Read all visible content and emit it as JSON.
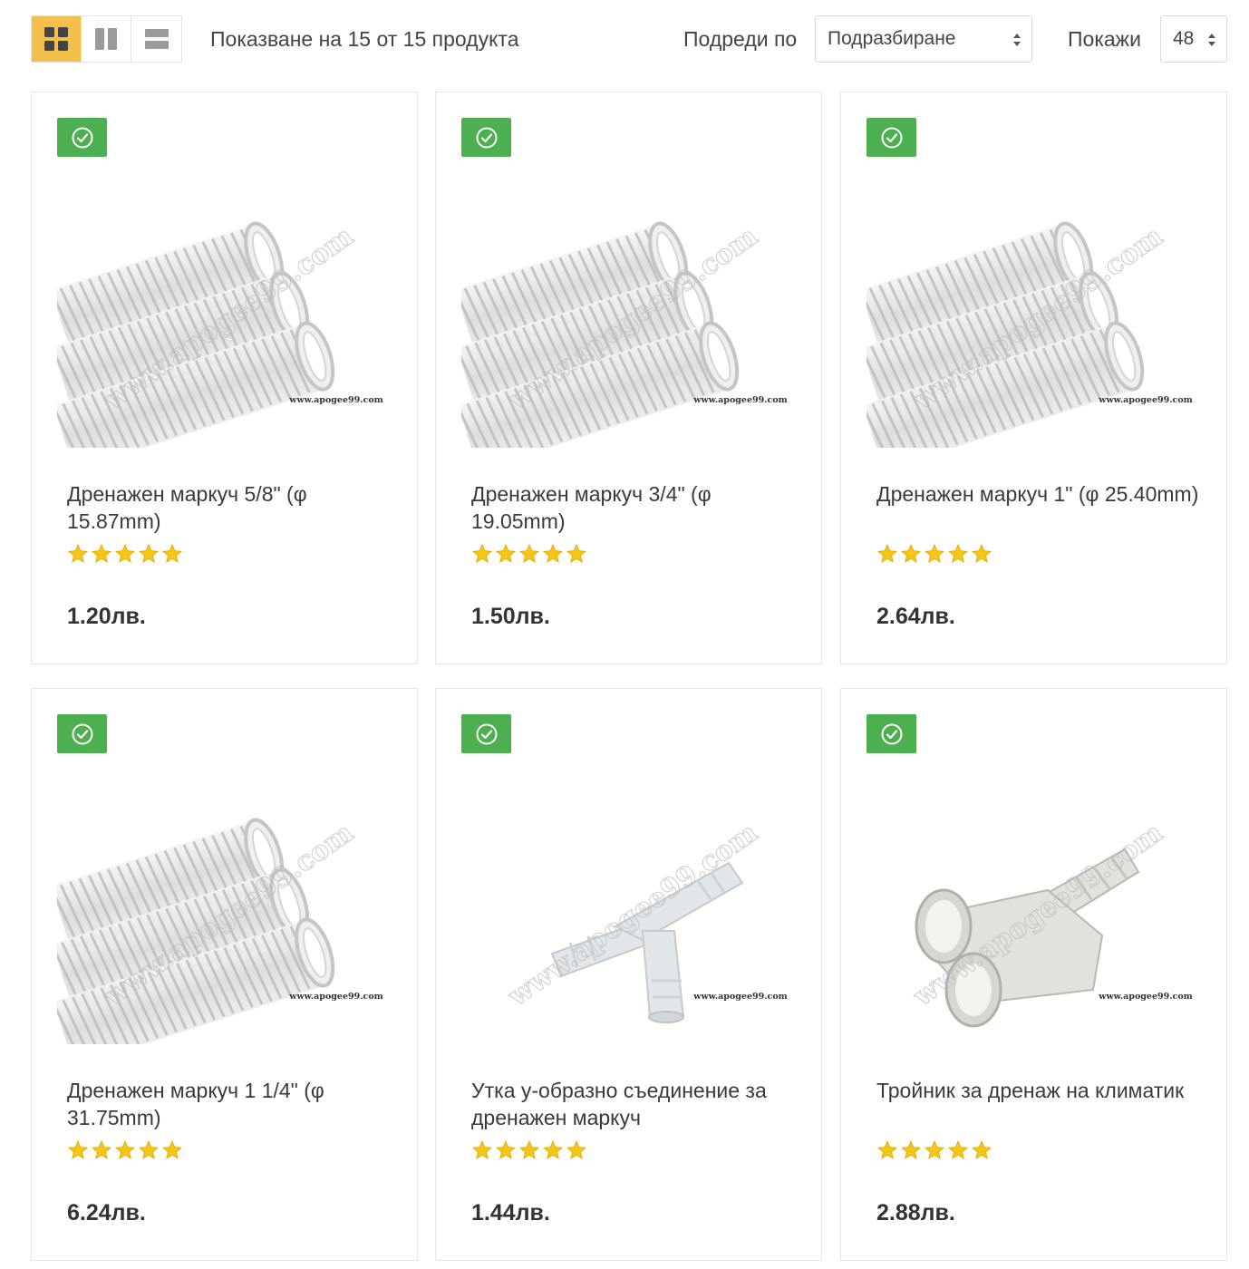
{
  "toolbar": {
    "view_modes": [
      {
        "icon": "grid-icon",
        "active": true
      },
      {
        "icon": "columns-icon",
        "active": false
      },
      {
        "icon": "list-icon",
        "active": false
      }
    ],
    "result_count": "Показване на 15 от 15 продукта",
    "sort_label": "Подреди по",
    "sort_value": "Подразбиране",
    "show_label": "Покажи",
    "show_value": "48"
  },
  "colors": {
    "accent": "#f3c04e",
    "badge": "#4caf50",
    "star": "#f5c518"
  },
  "products": [
    {
      "title": "Дренажен маркуч 5/8\" (φ 15.87mm)",
      "price": "1.20лв.",
      "rating": 5,
      "image": "hose-image",
      "watermark": "www.apogee99.com",
      "caption": "www.apogee99.com"
    },
    {
      "title": "Дренажен маркуч 3/4\" (φ 19.05mm)",
      "price": "1.50лв.",
      "rating": 5,
      "image": "hose-image",
      "watermark": "www.apogee99.com",
      "caption": "www.apogee99.com"
    },
    {
      "title": "Дренажен маркуч 1\" (φ 25.40mm)",
      "price": "2.64лв.",
      "rating": 5,
      "image": "hose-image",
      "watermark": "www.apogee99.com",
      "caption": "www.apogee99.com"
    },
    {
      "title": "Дренажен маркуч 1 1/4\" (φ 31.75mm)",
      "price": "6.24лв.",
      "rating": 5,
      "image": "hose-image",
      "watermark": "www.apogee99.com",
      "caption": "www.apogee99.com"
    },
    {
      "title": "Утка у-образно съединение за дренажен маркуч",
      "price": "1.44лв.",
      "rating": 5,
      "image": "y-connector-image",
      "watermark": "www.apogee99.com",
      "caption": "www.apogee99.com"
    },
    {
      "title": "Тройник за дренаж на климатик",
      "price": "2.88лв.",
      "rating": 5,
      "image": "tee-connector-image",
      "watermark": "www.apogee99.com",
      "caption": "www.apogee99.com"
    }
  ]
}
